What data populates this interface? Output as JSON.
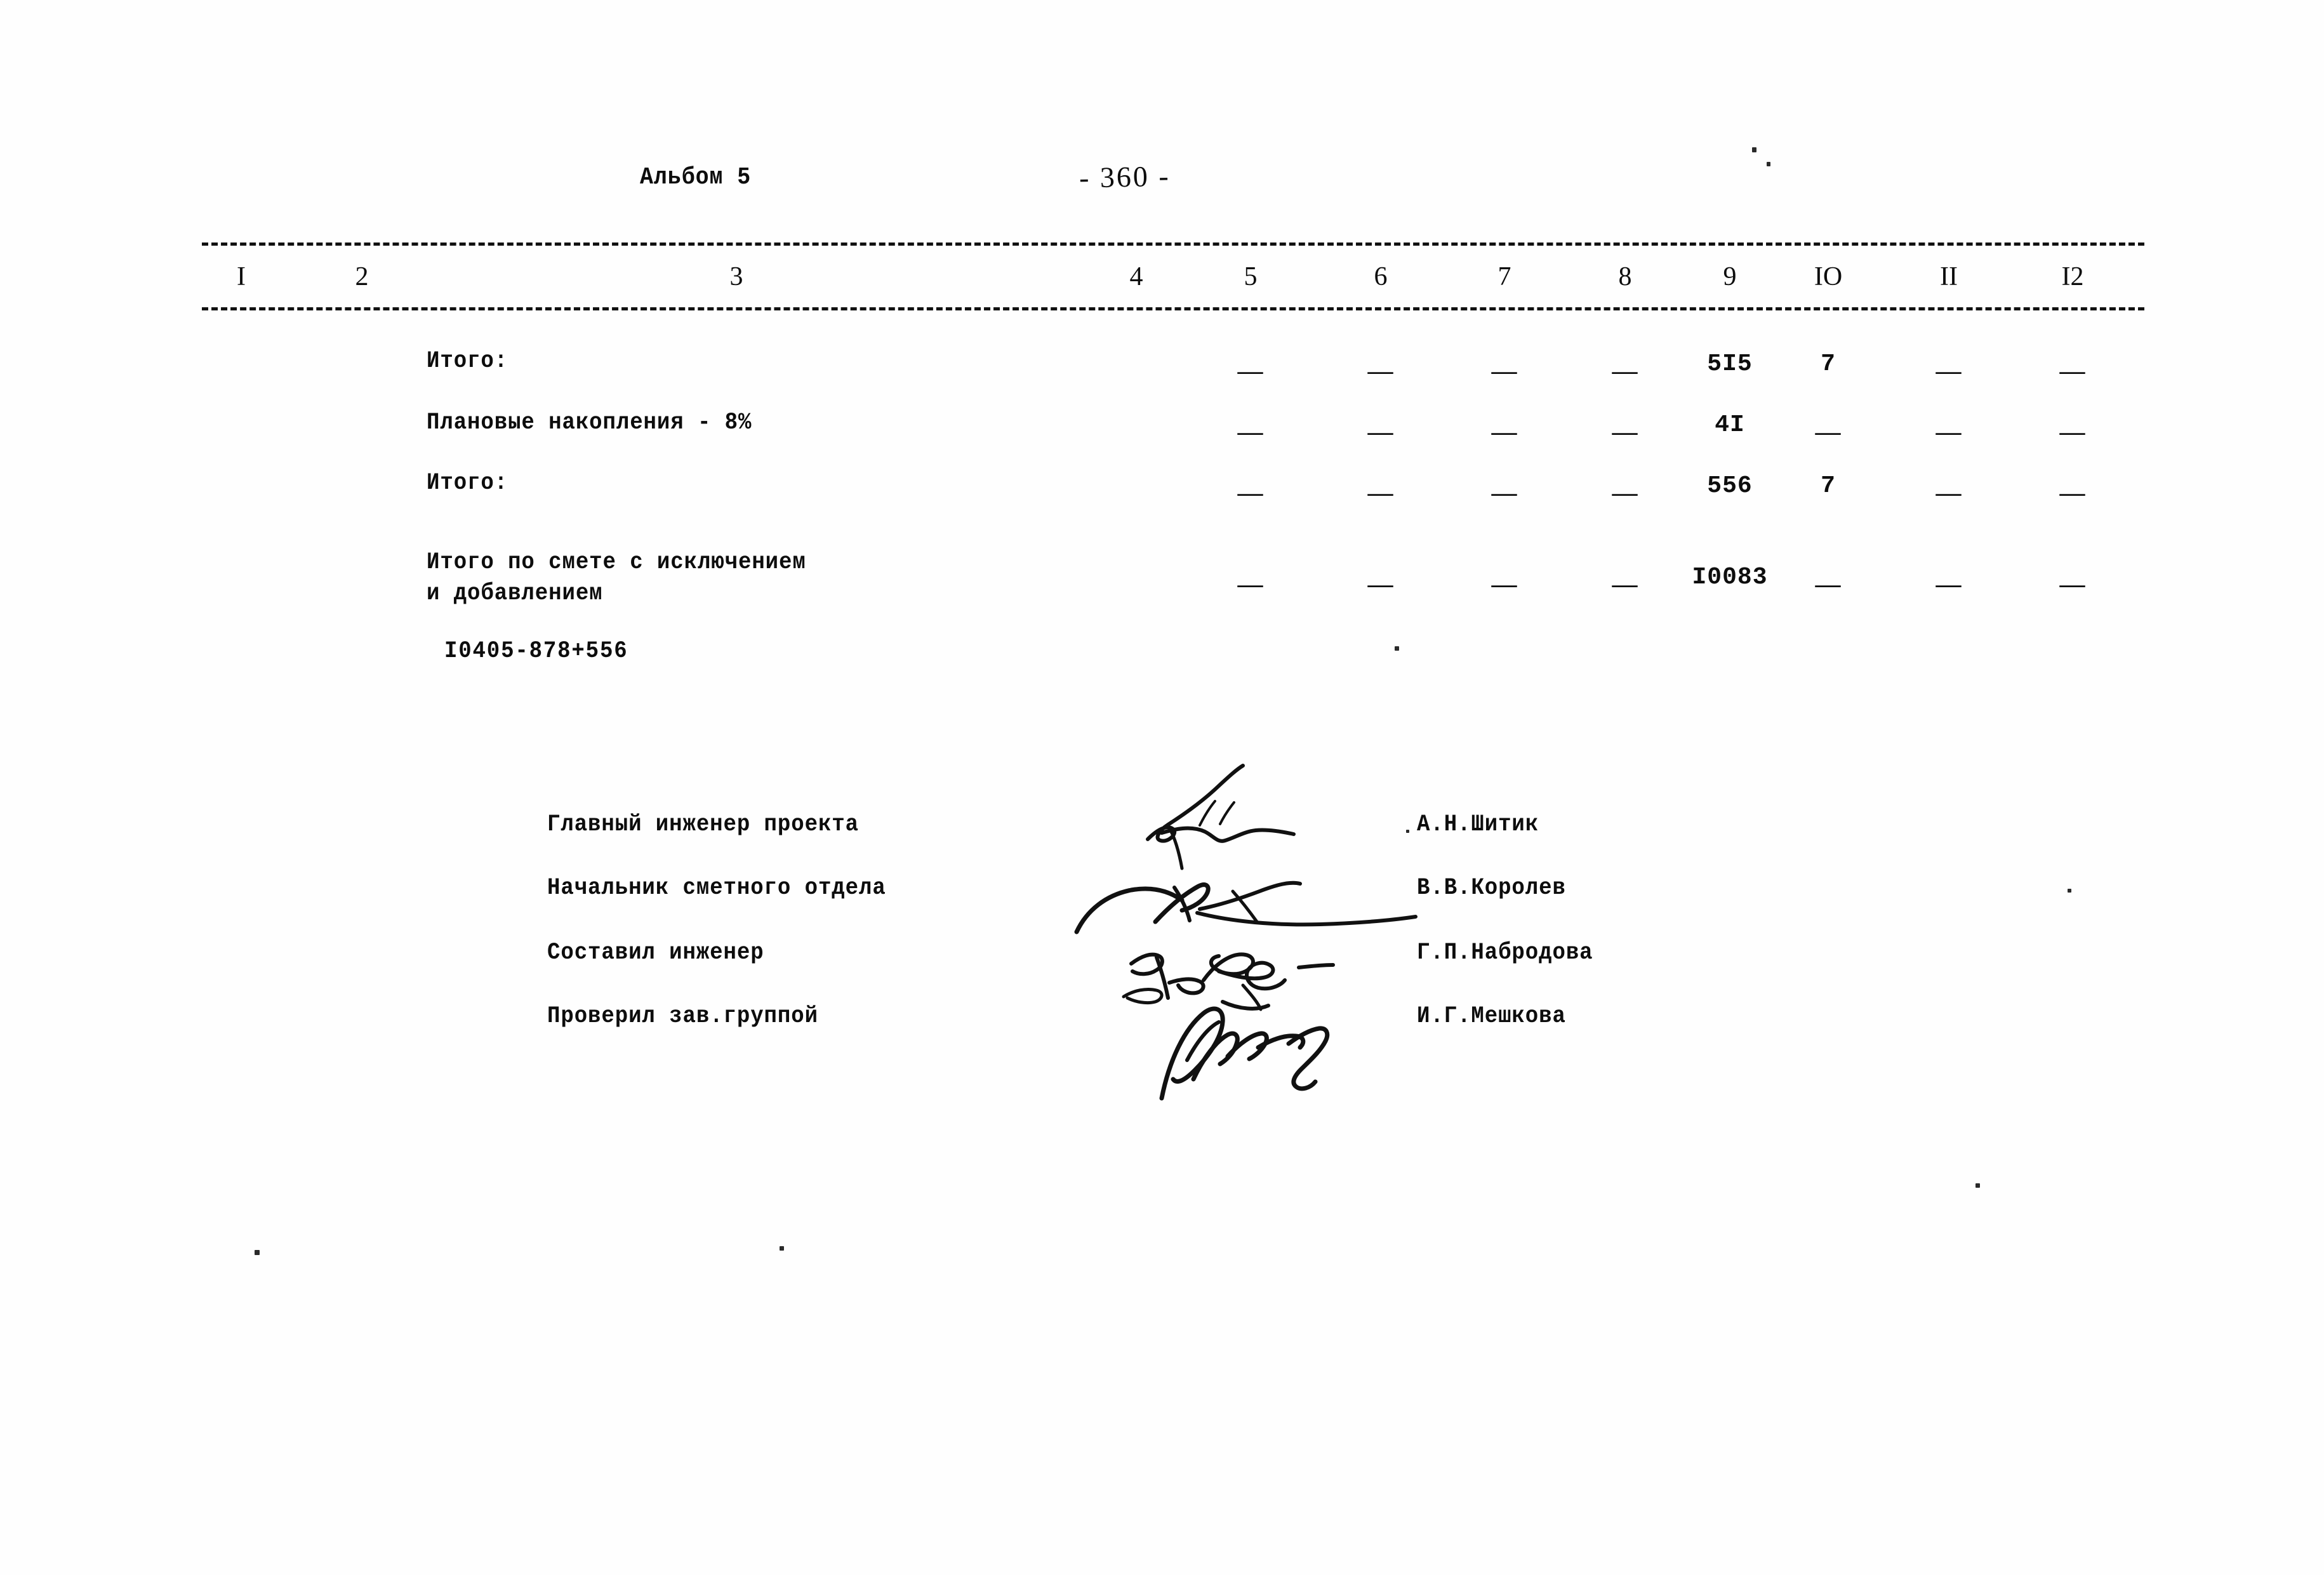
{
  "document": {
    "album_label": "Альбом 5",
    "page_number": "- 360 -"
  },
  "table": {
    "column_headers": [
      "I",
      "2",
      "3",
      "4",
      "5",
      "6",
      "7",
      "8",
      "9",
      "IO",
      "II",
      "I2"
    ],
    "rows": [
      {
        "label": "Итого:",
        "label_line2": "",
        "cells": [
          "",
          "",
          "",
          "",
          "—",
          "—",
          "—",
          "—",
          "5I5",
          "7",
          "—",
          "—"
        ]
      },
      {
        "label": "Плановые накопления - 8%",
        "label_line2": "",
        "cells": [
          "",
          "",
          "",
          "",
          "—",
          "—",
          "—",
          "—",
          "4I",
          "—",
          "—",
          "—"
        ]
      },
      {
        "label": "Итого:",
        "label_line2": "",
        "cells": [
          "",
          "",
          "",
          "",
          "—",
          "—",
          "—",
          "—",
          "556",
          "7",
          "—",
          "—"
        ]
      },
      {
        "label": "Итого по смете с исключением",
        "label_line2": "и добавлением",
        "cells": [
          "",
          "",
          "",
          "",
          "—",
          "—",
          "—",
          "—",
          "I0083",
          "—",
          "—",
          "—"
        ]
      }
    ],
    "calculation_line": "I0405-878+556"
  },
  "signature_block": {
    "entries": [
      {
        "role": "Главный инженер проекта",
        "name": "А.Н.Шитик"
      },
      {
        "role": "Начальник сметного отдела",
        "name": "В.В.Королев"
      },
      {
        "role": "Составил инженер",
        "name": "Г.П.Набродова"
      },
      {
        "role": "Проверил зав.группой",
        "name": "И.Г.Мешкова"
      }
    ]
  },
  "colors": {
    "paper": "#fefefe",
    "ink": "#0d0d0d",
    "pen_ink": "#111111"
  }
}
